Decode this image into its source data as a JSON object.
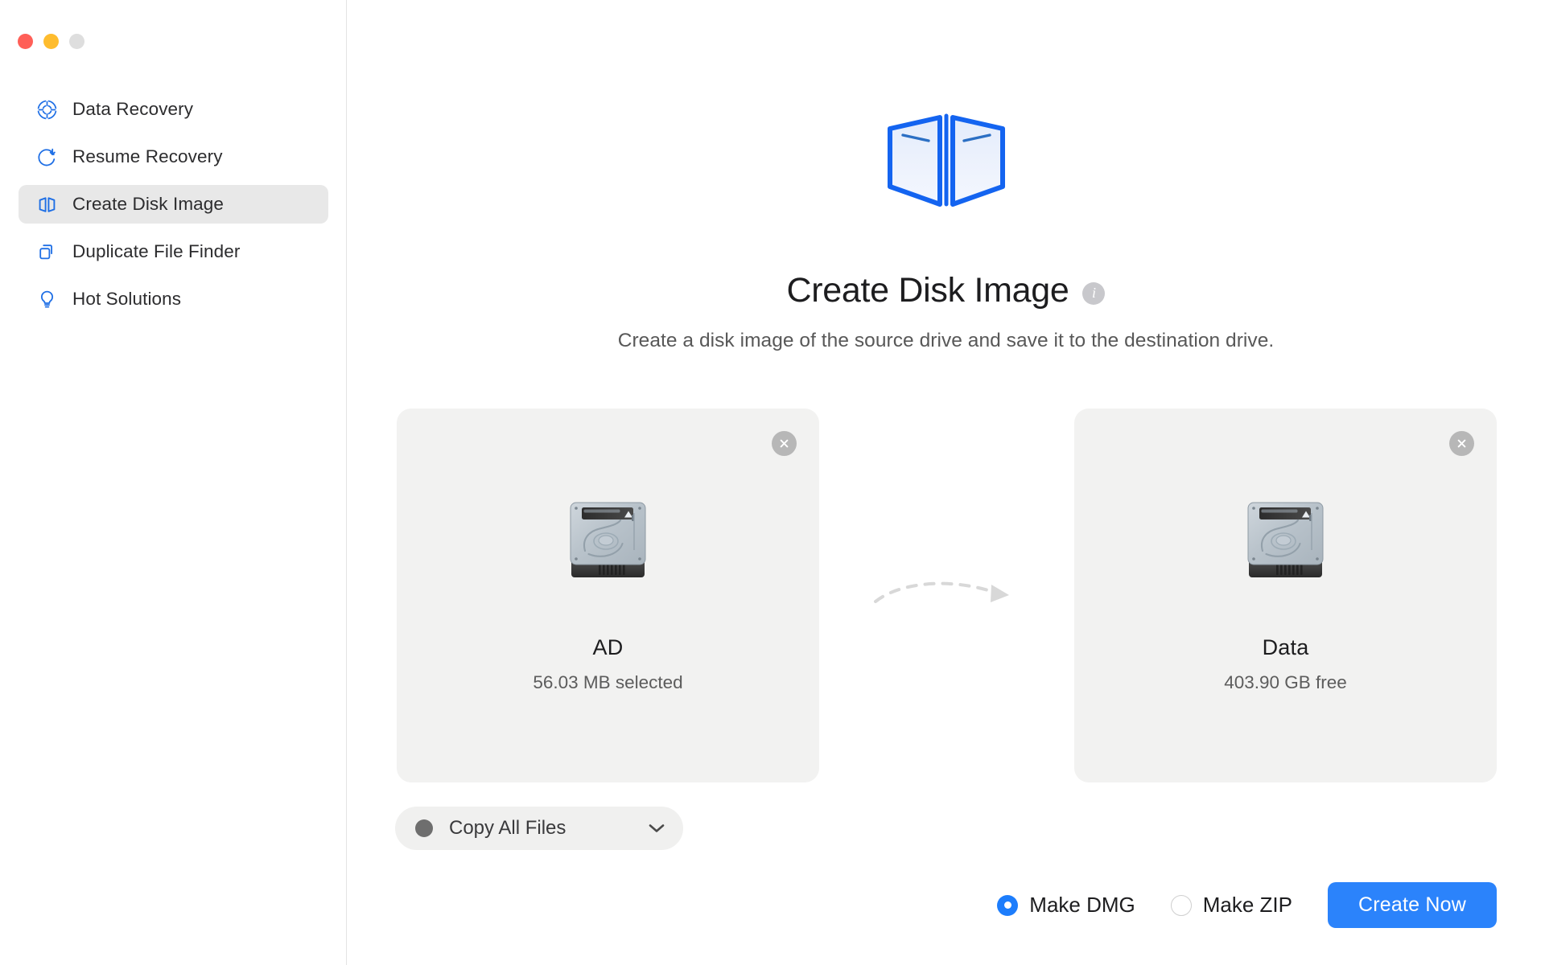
{
  "window": {
    "traffic_lights": [
      {
        "name": "close",
        "color": "#FF5F57"
      },
      {
        "name": "minimize",
        "color": "#FEBC2E"
      },
      {
        "name": "zoom",
        "color": "#DEDEDE"
      }
    ]
  },
  "sidebar": {
    "items": [
      {
        "label": "Data Recovery",
        "icon": "target-icon",
        "active": false
      },
      {
        "label": "Resume Recovery",
        "icon": "refresh-down-icon",
        "active": false
      },
      {
        "label": "Create Disk Image",
        "icon": "disk-image-icon",
        "active": true
      },
      {
        "label": "Duplicate File Finder",
        "icon": "copy-files-icon",
        "active": false
      },
      {
        "label": "Hot Solutions",
        "icon": "lightbulb-icon",
        "active": false
      }
    ]
  },
  "main": {
    "hero_icon": "disk-image-logo",
    "title": "Create Disk Image",
    "info_icon_label": "i",
    "subtitle": "Create a disk image of the source drive and save it to the destination drive.",
    "source_card": {
      "icon": "hard-drive-icon",
      "name": "AD",
      "detail": "56.03 MB selected",
      "close_icon": "close-circle-icon"
    },
    "destination_card": {
      "icon": "hard-drive-icon",
      "name": "Data",
      "detail": "403.90 GB free",
      "close_icon": "close-circle-icon"
    },
    "arrow_icon": "dashed-curved-arrow-right",
    "copy_select": {
      "value": "Copy All Files",
      "chevron_icon": "chevron-down-icon",
      "bullet_icon": "filled-circle-icon"
    }
  },
  "footer": {
    "options": [
      {
        "label": "Make DMG",
        "selected": true
      },
      {
        "label": "Make ZIP",
        "selected": false
      }
    ],
    "primary_button": "Create Now"
  },
  "colors": {
    "accent": "#2B83FB",
    "sidebar_icon": "#1f6fe5",
    "card_bg": "#F2F2F1",
    "active_nav_bg": "#E8E8E8"
  }
}
